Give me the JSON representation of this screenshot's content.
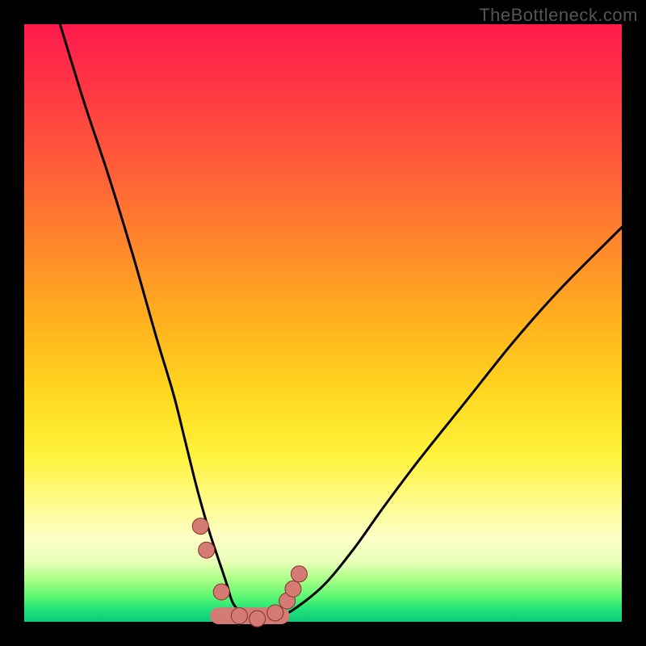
{
  "watermark": "TheBottleneck.com",
  "chart_data": {
    "type": "line",
    "title": "",
    "xlabel": "",
    "ylabel": "",
    "xlim": [
      0,
      100
    ],
    "ylim": [
      0,
      100
    ],
    "grid": false,
    "series": [
      {
        "name": "bottleneck-curve",
        "x": [
          6,
          10,
          14,
          18,
          22,
          25,
          27,
          29,
          31,
          33,
          34,
          35,
          37,
          40,
          42,
          45,
          50,
          55,
          60,
          66,
          74,
          82,
          90,
          100
        ],
        "values": [
          100,
          87,
          75,
          62,
          48,
          38,
          30,
          22,
          15,
          9,
          6,
          3,
          1,
          0,
          0.5,
          2,
          6,
          12,
          19,
          27,
          37,
          47,
          56,
          66
        ]
      }
    ],
    "markers": {
      "name": "highlight-dots",
      "color": "#d47b74",
      "stroke": "#8a2e2e",
      "points": [
        {
          "x": 29.5,
          "y": 16
        },
        {
          "x": 30.5,
          "y": 12
        },
        {
          "x": 33,
          "y": 5
        },
        {
          "x": 36,
          "y": 1
        },
        {
          "x": 39,
          "y": 0.5
        },
        {
          "x": 42,
          "y": 1.5
        },
        {
          "x": 44,
          "y": 3.5
        },
        {
          "x": 45,
          "y": 5.5
        },
        {
          "x": 46,
          "y": 8
        }
      ]
    },
    "trough_band": {
      "color": "#d47b74",
      "stroke": "#8a2e2e",
      "x_start": 32.5,
      "x_end": 43,
      "y": 1,
      "thickness_pct": 2.8
    }
  }
}
